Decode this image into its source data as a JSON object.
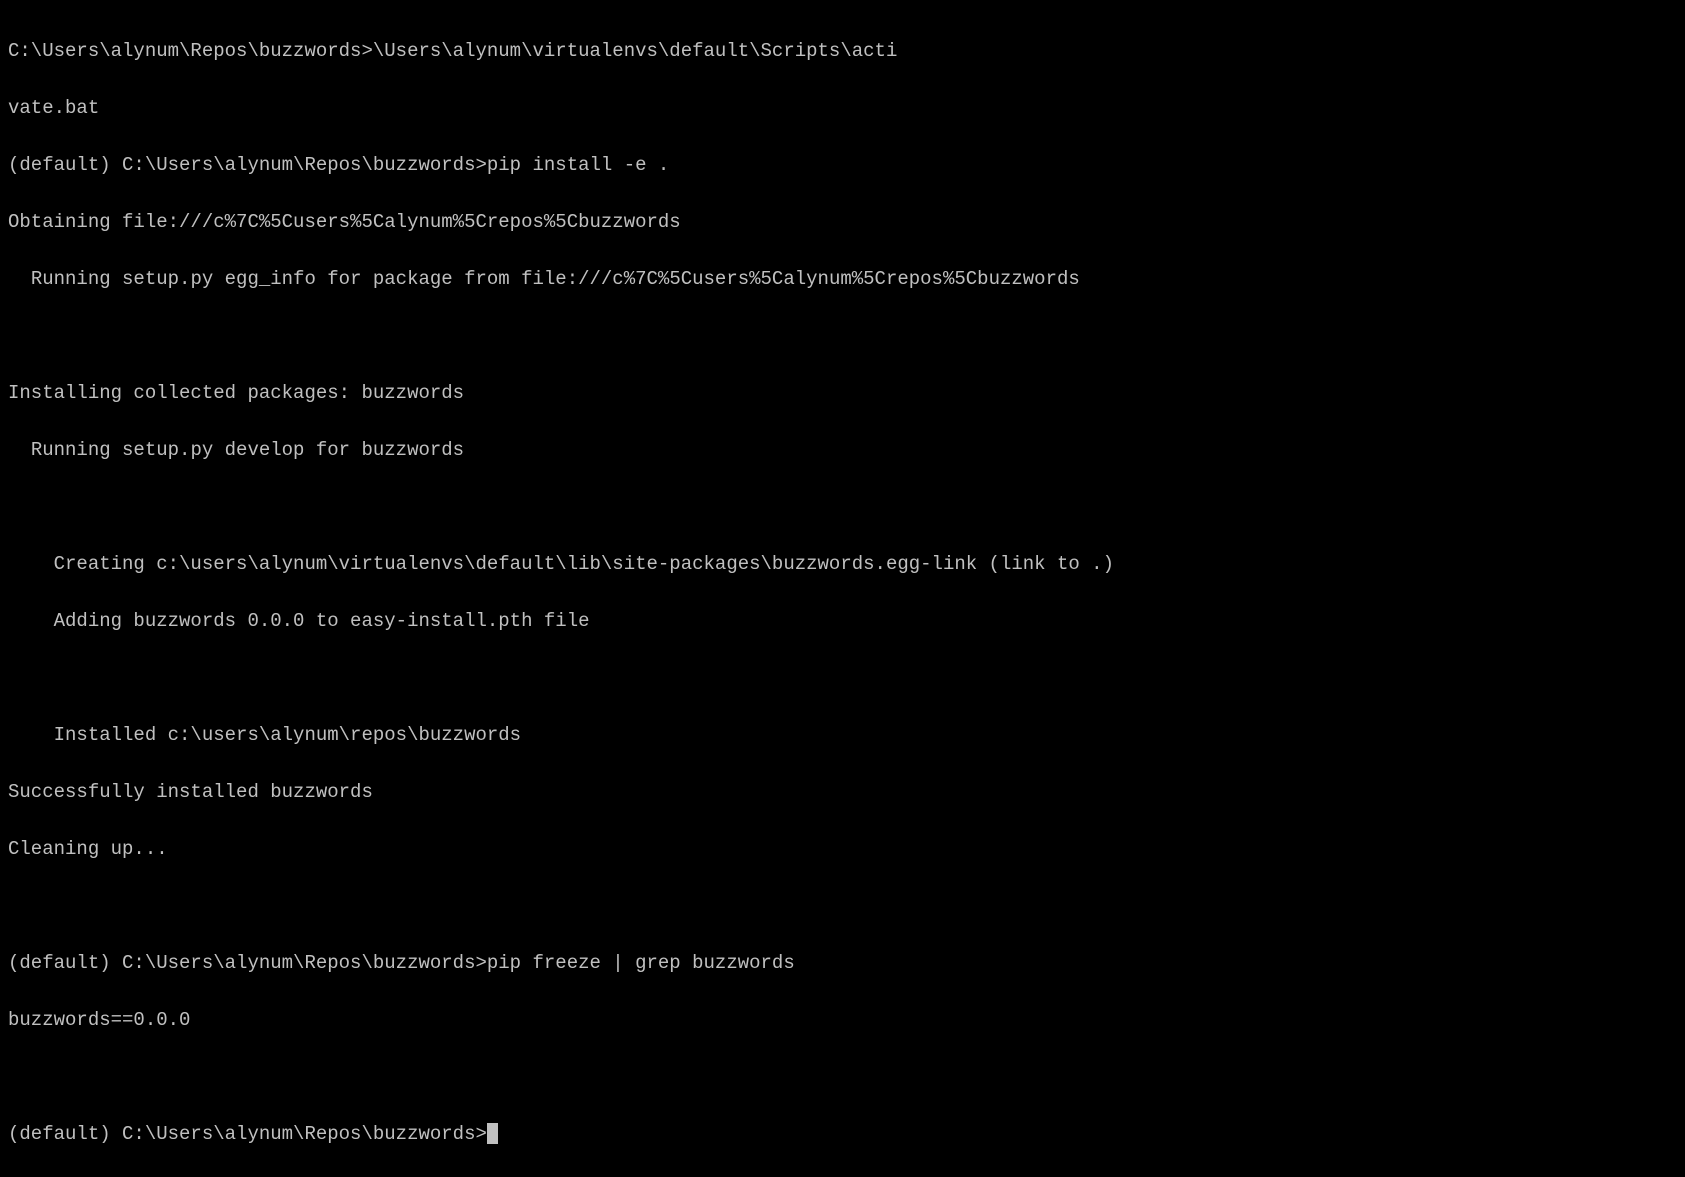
{
  "colors": {
    "background": "#000000",
    "foreground": "#c0c0c0"
  },
  "lines": {
    "l0": "C:\\Users\\alynum\\Repos\\buzzwords>\\Users\\alynum\\virtualenvs\\default\\Scripts\\acti",
    "l1": "vate.bat",
    "l2": "(default) C:\\Users\\alynum\\Repos\\buzzwords>pip install -e .",
    "l3": "Obtaining file:///c%7C%5Cusers%5Calynum%5Crepos%5Cbuzzwords",
    "l4": "  Running setup.py egg_info for package from file:///c%7C%5Cusers%5Calynum%5Crepos%5Cbuzzwords",
    "l5": "",
    "l6": "Installing collected packages: buzzwords",
    "l7": "  Running setup.py develop for buzzwords",
    "l8": "",
    "l9": "    Creating c:\\users\\alynum\\virtualenvs\\default\\lib\\site-packages\\buzzwords.egg-link (link to .)",
    "l10": "    Adding buzzwords 0.0.0 to easy-install.pth file",
    "l11": "",
    "l12": "    Installed c:\\users\\alynum\\repos\\buzzwords",
    "l13": "Successfully installed buzzwords",
    "l14": "Cleaning up...",
    "l15": "",
    "l16": "(default) C:\\Users\\alynum\\Repos\\buzzwords>pip freeze | grep buzzwords",
    "l17": "buzzwords==0.0.0",
    "l18": "",
    "l19": "(default) C:\\Users\\alynum\\Repos\\buzzwords>"
  }
}
